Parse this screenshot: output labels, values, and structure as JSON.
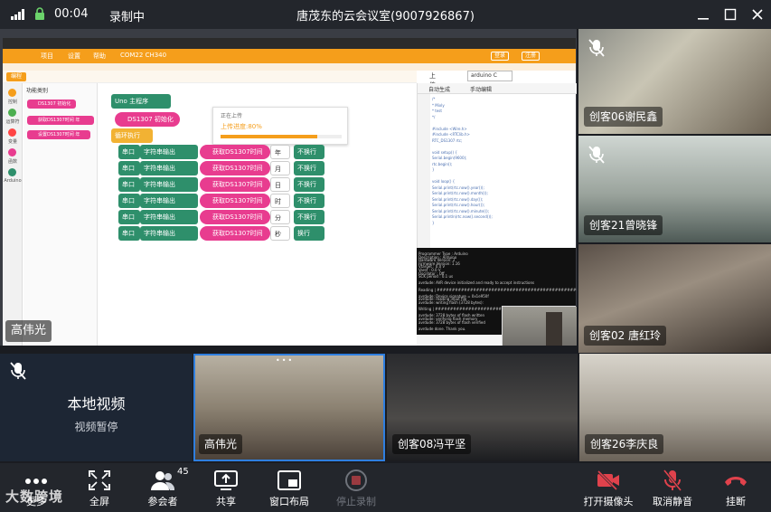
{
  "topbar": {
    "time": "00:04",
    "recording": "录制中",
    "title": "唐茂东的云会议室(9007926867)"
  },
  "stage": {
    "presenter_name": "高伟光",
    "ide": {
      "menu": [
        "项目",
        "设置",
        "帮助",
        "COM22 CH340"
      ],
      "menu_buttons": [
        "登录",
        "注册"
      ],
      "tab_label": "编程",
      "upload_label": "上传到板",
      "board_select": "arduino C",
      "sidebar_categories": [
        "控制",
        "运算符",
        "变量",
        "函数",
        "Arduino"
      ],
      "palette_title": "功能类别",
      "palette_blocks": [
        "DS1307 初始化",
        "获取DS1307时间 年",
        "设置DS1307时间 年"
      ],
      "blocks": {
        "main": "Uno 主程序",
        "init": "DS1307 初始化",
        "loop": "循环执行",
        "serial": "串口",
        "mode": "字符串输出",
        "get": "获取DS1307时间",
        "units": [
          "年",
          "月",
          "日",
          "时",
          "分",
          "秒"
        ],
        "no_newline": "不换行",
        "newline": "换行"
      },
      "progress": {
        "title": "正在上传",
        "label": "上传进度:80%",
        "percent": 80
      },
      "code_tabs": [
        "自动生成",
        "手动编辑"
      ],
      "code_lines": [
        "/*",
        " * Mixly",
        " * test",
        " */",
        "",
        "#include <Wire.h>",
        "#include <RTClib.h>",
        "RTC_DS1307 rtc;",
        "",
        "void setup() {",
        "  Serial.begin(9600);",
        "  rtc.begin();",
        "}",
        "",
        "void loop() {",
        "  Serial.print(rtc.now().year());",
        "  Serial.print(rtc.now().month());",
        "  Serial.print(rtc.now().day());",
        "  Serial.print(rtc.now().hour());",
        "  Serial.print(rtc.now().minute());",
        "  Serial.println(rtc.now().second());",
        "}"
      ],
      "terminal_lines": [
        "Programmer Type : Arduino",
        "Description     : Arduino",
        "Hardware Version: 2",
        "Firmware Version: 1.16",
        "Vtarget         : 0.0 V",
        "Varef           : 0.0 V",
        "Oscillator      : Off",
        "SCK period      : 0.1 us",
        "",
        "avrdude: AVR device initialized and ready to accept instructions",
        "",
        "Reading | ################################################## | 100% 0.00s",
        "",
        "avrdude: Device signature = 0x1e950f",
        "avrdude: reading input file",
        "avrdude: writing flash (3728 bytes):",
        "",
        "Writing | ################################################## | 100% 0.62s",
        "",
        "avrdude: 3728 bytes of flash written",
        "avrdude: verifying flash memory",
        "avrdude: 3728 bytes of flash verified",
        "",
        "avrdude done.  Thank you."
      ]
    }
  },
  "participants_right": [
    {
      "name": "创客06谢民鑫",
      "muted": true
    },
    {
      "name": "创客21曾晓锋",
      "muted": true
    },
    {
      "name": "创客02 唐红玲",
      "muted": false
    }
  ],
  "participants_bottom": [
    {
      "name": "高伟光"
    },
    {
      "name": "创客08冯平坚"
    },
    {
      "name": "创客26李庆良"
    }
  ],
  "local_video": {
    "title": "本地视频",
    "subtitle": "视频暂停"
  },
  "toolbar": {
    "more": "更多",
    "fullscreen": "全屏",
    "participants": "参会者",
    "participant_count": "45",
    "share": "共享",
    "layout": "窗口布局",
    "stop_recording": "停止录制",
    "camera_on": "打开摄像头",
    "unmute": "取消静音",
    "hangup": "挂断"
  },
  "watermark": "大数跨境",
  "colors": {
    "accent": "#2f7fe0",
    "mixly_orange": "#f59e1b",
    "hangup_red": "#e0424c",
    "lock_green": "#6bd36b"
  }
}
